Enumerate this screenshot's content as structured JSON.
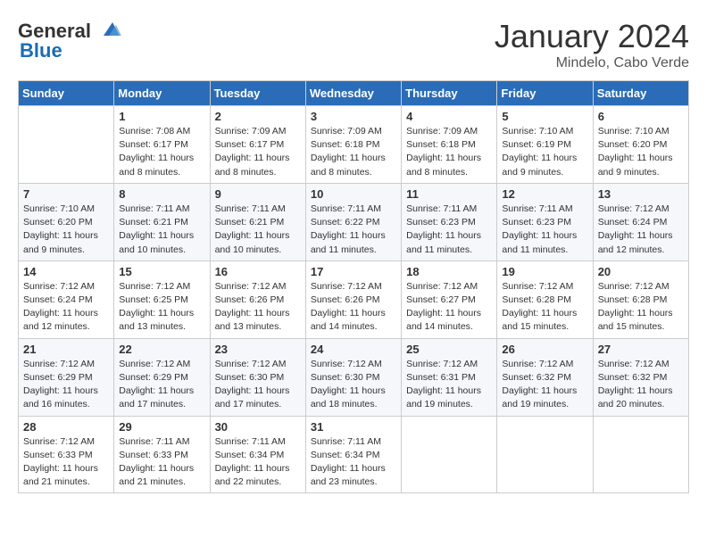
{
  "header": {
    "logo": {
      "general": "General",
      "blue": "Blue"
    },
    "month": "January 2024",
    "location": "Mindelo, Cabo Verde"
  },
  "weekdays": [
    "Sunday",
    "Monday",
    "Tuesday",
    "Wednesday",
    "Thursday",
    "Friday",
    "Saturday"
  ],
  "weeks": [
    [
      {
        "day": "",
        "info": ""
      },
      {
        "day": "1",
        "info": "Sunrise: 7:08 AM\nSunset: 6:17 PM\nDaylight: 11 hours\nand 8 minutes."
      },
      {
        "day": "2",
        "info": "Sunrise: 7:09 AM\nSunset: 6:17 PM\nDaylight: 11 hours\nand 8 minutes."
      },
      {
        "day": "3",
        "info": "Sunrise: 7:09 AM\nSunset: 6:18 PM\nDaylight: 11 hours\nand 8 minutes."
      },
      {
        "day": "4",
        "info": "Sunrise: 7:09 AM\nSunset: 6:18 PM\nDaylight: 11 hours\nand 8 minutes."
      },
      {
        "day": "5",
        "info": "Sunrise: 7:10 AM\nSunset: 6:19 PM\nDaylight: 11 hours\nand 9 minutes."
      },
      {
        "day": "6",
        "info": "Sunrise: 7:10 AM\nSunset: 6:20 PM\nDaylight: 11 hours\nand 9 minutes."
      }
    ],
    [
      {
        "day": "7",
        "info": "Sunrise: 7:10 AM\nSunset: 6:20 PM\nDaylight: 11 hours\nand 9 minutes."
      },
      {
        "day": "8",
        "info": "Sunrise: 7:11 AM\nSunset: 6:21 PM\nDaylight: 11 hours\nand 10 minutes."
      },
      {
        "day": "9",
        "info": "Sunrise: 7:11 AM\nSunset: 6:21 PM\nDaylight: 11 hours\nand 10 minutes."
      },
      {
        "day": "10",
        "info": "Sunrise: 7:11 AM\nSunset: 6:22 PM\nDaylight: 11 hours\nand 11 minutes."
      },
      {
        "day": "11",
        "info": "Sunrise: 7:11 AM\nSunset: 6:23 PM\nDaylight: 11 hours\nand 11 minutes."
      },
      {
        "day": "12",
        "info": "Sunrise: 7:11 AM\nSunset: 6:23 PM\nDaylight: 11 hours\nand 11 minutes."
      },
      {
        "day": "13",
        "info": "Sunrise: 7:12 AM\nSunset: 6:24 PM\nDaylight: 11 hours\nand 12 minutes."
      }
    ],
    [
      {
        "day": "14",
        "info": "Sunrise: 7:12 AM\nSunset: 6:24 PM\nDaylight: 11 hours\nand 12 minutes."
      },
      {
        "day": "15",
        "info": "Sunrise: 7:12 AM\nSunset: 6:25 PM\nDaylight: 11 hours\nand 13 minutes."
      },
      {
        "day": "16",
        "info": "Sunrise: 7:12 AM\nSunset: 6:26 PM\nDaylight: 11 hours\nand 13 minutes."
      },
      {
        "day": "17",
        "info": "Sunrise: 7:12 AM\nSunset: 6:26 PM\nDaylight: 11 hours\nand 14 minutes."
      },
      {
        "day": "18",
        "info": "Sunrise: 7:12 AM\nSunset: 6:27 PM\nDaylight: 11 hours\nand 14 minutes."
      },
      {
        "day": "19",
        "info": "Sunrise: 7:12 AM\nSunset: 6:28 PM\nDaylight: 11 hours\nand 15 minutes."
      },
      {
        "day": "20",
        "info": "Sunrise: 7:12 AM\nSunset: 6:28 PM\nDaylight: 11 hours\nand 15 minutes."
      }
    ],
    [
      {
        "day": "21",
        "info": "Sunrise: 7:12 AM\nSunset: 6:29 PM\nDaylight: 11 hours\nand 16 minutes."
      },
      {
        "day": "22",
        "info": "Sunrise: 7:12 AM\nSunset: 6:29 PM\nDaylight: 11 hours\nand 17 minutes."
      },
      {
        "day": "23",
        "info": "Sunrise: 7:12 AM\nSunset: 6:30 PM\nDaylight: 11 hours\nand 17 minutes."
      },
      {
        "day": "24",
        "info": "Sunrise: 7:12 AM\nSunset: 6:30 PM\nDaylight: 11 hours\nand 18 minutes."
      },
      {
        "day": "25",
        "info": "Sunrise: 7:12 AM\nSunset: 6:31 PM\nDaylight: 11 hours\nand 19 minutes."
      },
      {
        "day": "26",
        "info": "Sunrise: 7:12 AM\nSunset: 6:32 PM\nDaylight: 11 hours\nand 19 minutes."
      },
      {
        "day": "27",
        "info": "Sunrise: 7:12 AM\nSunset: 6:32 PM\nDaylight: 11 hours\nand 20 minutes."
      }
    ],
    [
      {
        "day": "28",
        "info": "Sunrise: 7:12 AM\nSunset: 6:33 PM\nDaylight: 11 hours\nand 21 minutes."
      },
      {
        "day": "29",
        "info": "Sunrise: 7:11 AM\nSunset: 6:33 PM\nDaylight: 11 hours\nand 21 minutes."
      },
      {
        "day": "30",
        "info": "Sunrise: 7:11 AM\nSunset: 6:34 PM\nDaylight: 11 hours\nand 22 minutes."
      },
      {
        "day": "31",
        "info": "Sunrise: 7:11 AM\nSunset: 6:34 PM\nDaylight: 11 hours\nand 23 minutes."
      },
      {
        "day": "",
        "info": ""
      },
      {
        "day": "",
        "info": ""
      },
      {
        "day": "",
        "info": ""
      }
    ]
  ]
}
